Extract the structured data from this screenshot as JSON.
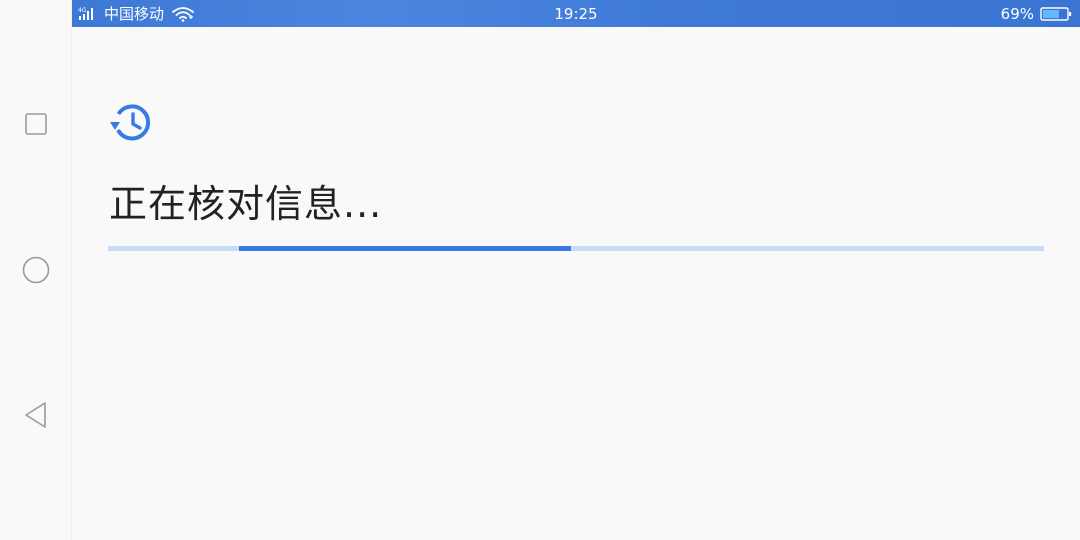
{
  "status_bar": {
    "signal_label": "4G",
    "carrier": "中国移动",
    "time": "19:25",
    "battery_text": "69%",
    "battery_level": 0.69,
    "signal_icon": "cellular-signal-icon",
    "wifi_icon": "wifi-icon",
    "battery_icon": "battery-icon"
  },
  "nav_bar": {
    "recent_icon": "square-recent-apps-icon",
    "home_icon": "circle-home-icon",
    "back_icon": "triangle-back-icon"
  },
  "main": {
    "icon": "history-clock-icon",
    "title": "正在核对信息...",
    "progress": {
      "indeterminate": true,
      "segment_start": 0.14,
      "segment_end": 0.495
    }
  },
  "colors": {
    "status_bar": "#3d78d6",
    "accent": "#3a7be3",
    "progress_track": "#c9dcf6",
    "background": "#f9f9fa",
    "title_text": "#222222"
  }
}
